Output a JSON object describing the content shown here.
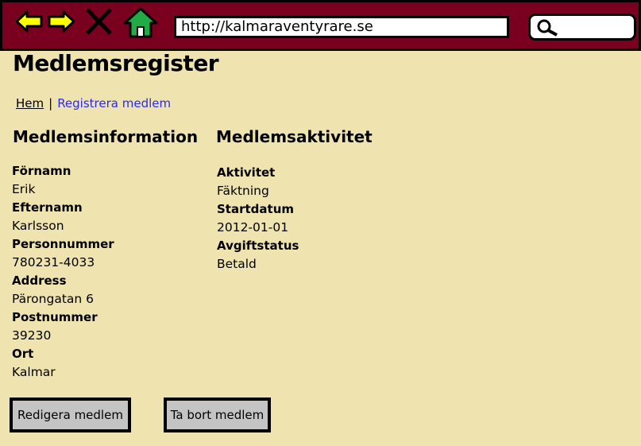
{
  "browser": {
    "url": "http://kalmaraventyrare.se",
    "icons": [
      "back-arrow-icon",
      "forward-arrow-icon",
      "close-x-icon",
      "home-icon",
      "search-magnifier-icon"
    ],
    "colors": {
      "toolbar": "#7a0020",
      "arrows": "#ffff00",
      "home": "#22aa44"
    }
  },
  "page": {
    "title": "Medlemsregister",
    "background": "#efe3b0"
  },
  "breadcrumb": {
    "home": "Hem",
    "separator": "|",
    "register": "Registrera medlem"
  },
  "member_info": {
    "heading": "Medlemsinformation",
    "fields": [
      {
        "label": "Förnamn",
        "value": "Erik"
      },
      {
        "label": "Efternamn",
        "value": "Karlsson"
      },
      {
        "label": "Personnummer",
        "value": "780231-4033"
      },
      {
        "label": "Address",
        "value": "Pärongatan 6"
      },
      {
        "label": "Postnummer",
        "value": "39230"
      },
      {
        "label": "Ort",
        "value": "Kalmar"
      }
    ]
  },
  "member_activity": {
    "heading": "Medlemsaktivitet",
    "fields": [
      {
        "label": "Aktivitet",
        "value": "Fäktning"
      },
      {
        "label": "Startdatum",
        "value": "2012-01-01"
      },
      {
        "label": "Avgiftstatus",
        "value": "Betald"
      }
    ]
  },
  "actions": {
    "edit": "Redigera medlem",
    "delete": "Ta bort medlem"
  }
}
